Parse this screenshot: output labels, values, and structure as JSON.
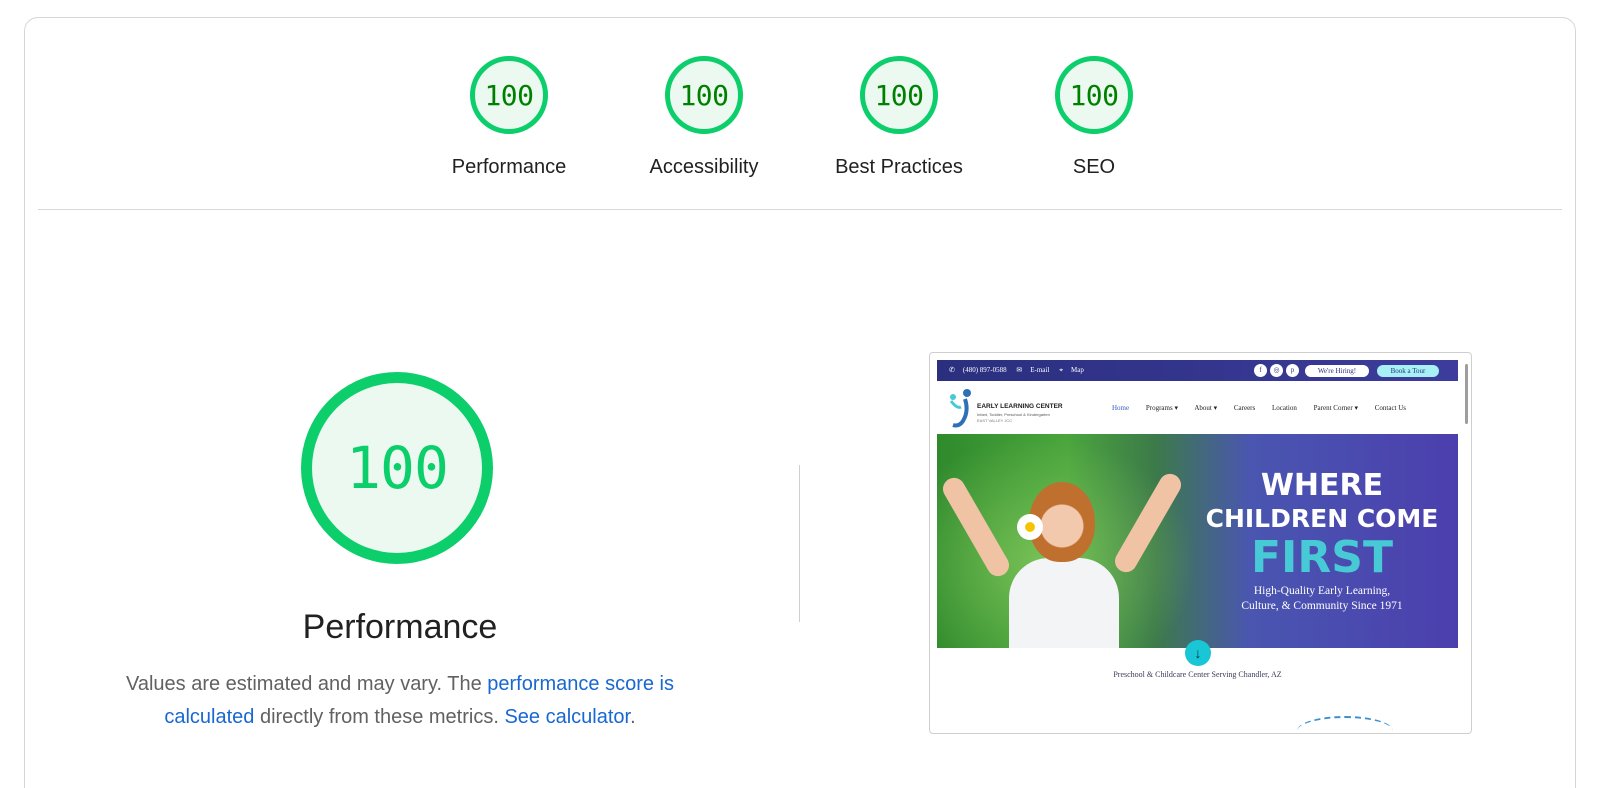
{
  "categories": [
    {
      "score": "100",
      "label": "Performance"
    },
    {
      "score": "100",
      "label": "Accessibility"
    },
    {
      "score": "100",
      "label": "Best Practices"
    },
    {
      "score": "100",
      "label": "SEO"
    }
  ],
  "main": {
    "score": "100",
    "title": "Performance",
    "desc_prefix": "Values are estimated and may vary. The ",
    "desc_link1": "performance score is calculated",
    "desc_middle": " directly from these metrics. ",
    "desc_link2": "See calculator",
    "desc_suffix": "."
  },
  "screenshot": {
    "topbar": {
      "phone": "(480) 897-0588",
      "email": "E-mail",
      "map": "Map",
      "social_icons": [
        "facebook-icon",
        "instagram-icon",
        "pinterest-icon"
      ],
      "hiring": "We're Hiring!",
      "tour": "Book a Tour"
    },
    "logo": {
      "name": "EARLY LEARNING CENTER",
      "sub": "Infant, Toddler, Preschool & Kindergarten",
      "location": "EAST VALLEY JCC"
    },
    "nav": [
      "Home",
      "Programs ▾",
      "About ▾",
      "Careers",
      "Location",
      "Parent Corner ▾",
      "Contact Us"
    ],
    "hero": {
      "line1": "WHERE",
      "line2": "CHILDREN COME",
      "line3": "FIRST",
      "sub1": "High-Quality Early Learning,",
      "sub2": "Culture, & Community Since 1971"
    },
    "tagline": "Preschool & Childcare Center Serving Chandler, AZ"
  },
  "colors": {
    "pass": "#0cce6b",
    "pass_text": "#008000",
    "pass_bg": "#ecf9f1",
    "link": "#1967d2"
  }
}
